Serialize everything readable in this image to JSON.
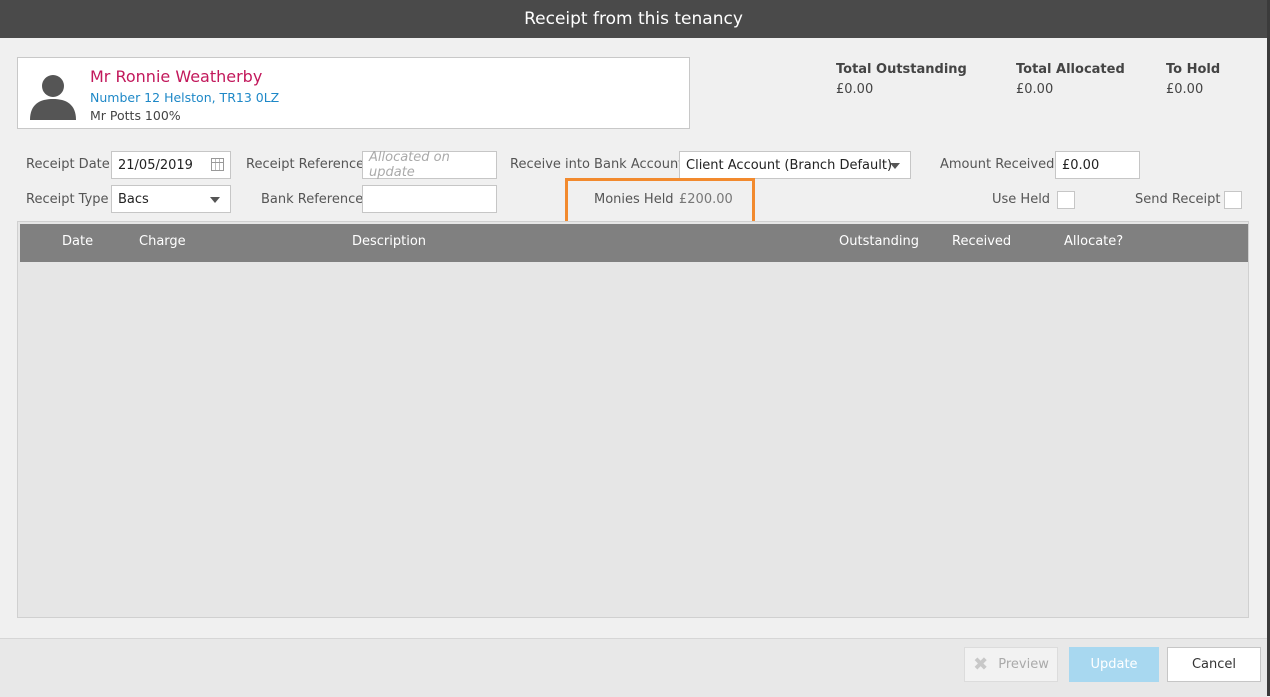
{
  "dialog": {
    "title": "Receipt from this tenancy"
  },
  "tenant": {
    "name": "Mr Ronnie Weatherby",
    "address": "Number 12 Helston, TR13 0LZ",
    "landlord": "Mr Potts 100%"
  },
  "totals": {
    "outstanding": {
      "label": "Total Outstanding",
      "value": "£0.00"
    },
    "allocated": {
      "label": "Total Allocated",
      "value": "£0.00"
    },
    "to_hold": {
      "label": "To Hold",
      "value": "£0.00"
    }
  },
  "form": {
    "receipt_date": {
      "label": "Receipt Date",
      "value": "21/05/2019"
    },
    "receipt_reference": {
      "label": "Receipt Reference",
      "placeholder": "Allocated on update"
    },
    "bank_account": {
      "label": "Receive into Bank Account",
      "value": "Client Account (Branch Default)"
    },
    "amount_received": {
      "label": "Amount Received",
      "value": "£0.00"
    },
    "receipt_type": {
      "label": "Receipt Type",
      "value": "Bacs"
    },
    "bank_reference": {
      "label": "Bank Reference",
      "value": ""
    },
    "monies_held": {
      "label": "Monies Held",
      "value": "£200.00"
    },
    "use_held": {
      "label": "Use Held",
      "checked": false
    },
    "send_receipt": {
      "label": "Send Receipt",
      "checked": false
    }
  },
  "table": {
    "columns": [
      "Date",
      "Charge",
      "Description",
      "Outstanding",
      "Received",
      "Allocate?"
    ],
    "rows": []
  },
  "footer": {
    "preview_label": "Preview",
    "update_label": "Update",
    "cancel_label": "Cancel"
  },
  "colors": {
    "highlight": "#f28a2e",
    "tenant_name": "#c2185b",
    "tenant_address": "#1e88c7",
    "header_bar": "#4a4a4a",
    "update_button": "#a8d8f0"
  }
}
